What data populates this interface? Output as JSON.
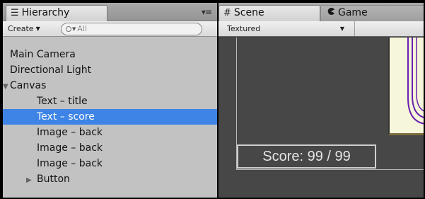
{
  "hierarchy": {
    "tab_label": "Hierarchy",
    "tab_icon": "list-icon",
    "menu_icon": "▾≡",
    "create_label": "Create",
    "search_placeholder": "All",
    "items": [
      {
        "label": "Main Camera",
        "level": 0
      },
      {
        "label": "Directional Light",
        "level": 0
      },
      {
        "label": "Canvas",
        "level": 0,
        "expanded": true
      },
      {
        "label": "Text – title",
        "level": 1
      },
      {
        "label": "Text – score",
        "level": 1,
        "selected": true
      },
      {
        "label": "Image – back",
        "level": 1
      },
      {
        "label": "Image – back",
        "level": 1
      },
      {
        "label": "Image – back",
        "level": 1
      },
      {
        "label": "Button",
        "level": 1,
        "expanded": false
      }
    ]
  },
  "scene": {
    "tab_label": "Scene",
    "tab_icon": "#",
    "game_tab_label": "Game",
    "game_tab_icon": "pacman-icon",
    "render_mode": "Textured",
    "score_text": "Score: 99 / 99"
  },
  "colors": {
    "selection": "#3d84e6",
    "scene_background": "#474747",
    "panel_background": "#c2c2c2"
  }
}
